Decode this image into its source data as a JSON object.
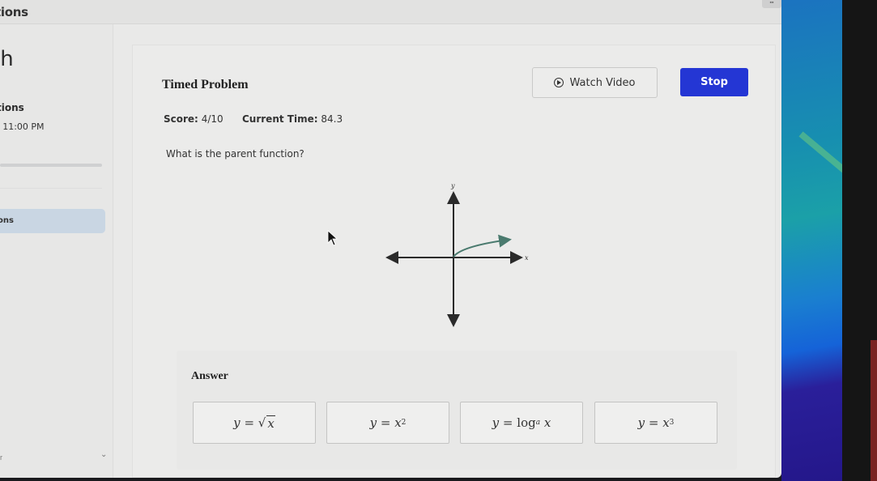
{
  "window": {
    "title_fragment": "tions",
    "control_glyph": "▪▪"
  },
  "sidebar": {
    "course_fragment": "th",
    "section_fragment": "tions",
    "due_fragment": ": 11:00 PM",
    "progress": 1.0,
    "active_item_fragment": "ons",
    "bottom_mark": "r",
    "chevron_glyph": "⌄"
  },
  "problem": {
    "title": "Timed Problem",
    "watch_video_label": "Watch Video",
    "stop_label": "Stop",
    "score_label": "Score:",
    "score_value": "4/10",
    "time_label": "Current Time:",
    "time_value": "84.3",
    "question": "What is the parent function?",
    "graph": {
      "x_label": "x",
      "y_label": "y",
      "curve_color": "#4a7a6e",
      "curve": "square-root curve starting at origin"
    }
  },
  "answer": {
    "label": "Answer",
    "choices": [
      {
        "id": "sqrt",
        "lhs": "y",
        "eq": "=",
        "text": "√x"
      },
      {
        "id": "square",
        "lhs": "y",
        "eq": "=",
        "base": "x",
        "exp": "2"
      },
      {
        "id": "log",
        "lhs": "y",
        "eq": "=",
        "fn": "log",
        "sub": "a",
        "arg": "x"
      },
      {
        "id": "cube",
        "lhs": "y",
        "eq": "=",
        "base": "x",
        "exp": "3"
      }
    ]
  },
  "colors": {
    "stop_button": "#2436d4",
    "background": "#e9e9e8"
  }
}
